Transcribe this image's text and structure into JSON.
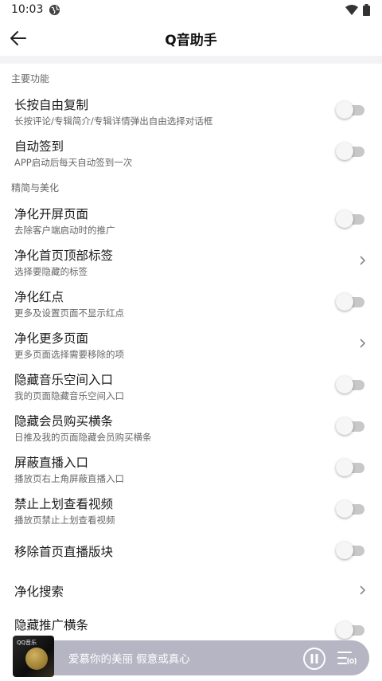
{
  "status_bar": {
    "time": "10:03"
  },
  "app_bar": {
    "title": "Q音助手"
  },
  "sections": [
    {
      "title": "主要功能",
      "items": [
        {
          "title": "长按自由复制",
          "desc": "长按评论/专辑简介/专辑详情弹出自由选择对话框",
          "control": "switch",
          "on": false
        },
        {
          "title": "自动签到",
          "desc": "APP启动后每天自动签到一次",
          "control": "switch",
          "on": false
        }
      ]
    },
    {
      "title": "精简与美化",
      "items": [
        {
          "title": "净化开屏页面",
          "desc": "去除客户端启动时的推广",
          "control": "switch",
          "on": false
        },
        {
          "title": "净化首页顶部标签",
          "desc": "选择要隐藏的标签",
          "control": "chevron"
        },
        {
          "title": "净化红点",
          "desc": "更多及设置页面不显示红点",
          "control": "switch",
          "on": false
        },
        {
          "title": "净化更多页面",
          "desc": "更多页面选择需要移除的项",
          "control": "chevron"
        },
        {
          "title": "隐藏音乐空间入口",
          "desc": "我的页面隐藏音乐空间入口",
          "control": "switch",
          "on": false
        },
        {
          "title": "隐藏会员购买横条",
          "desc": "日推及我的页面隐藏会员购买横条",
          "control": "switch",
          "on": false
        },
        {
          "title": "屏蔽直播入口",
          "desc": "播放页右上角屏蔽直播入口",
          "control": "switch",
          "on": false
        },
        {
          "title": "禁止上划查看视频",
          "desc": "播放页禁止上划查看视频",
          "control": "switch",
          "on": false
        },
        {
          "title": "移除首页直播版块",
          "desc": "",
          "control": "switch",
          "on": false
        },
        {
          "title": "净化搜索",
          "desc": "",
          "control": "chevron"
        },
        {
          "title": "隐藏推广横条",
          "desc": "",
          "control": "switch",
          "on": false
        }
      ]
    }
  ],
  "player": {
    "song": "爱慕你的美丽 假意或真心",
    "cover_label": "QQ音乐"
  }
}
